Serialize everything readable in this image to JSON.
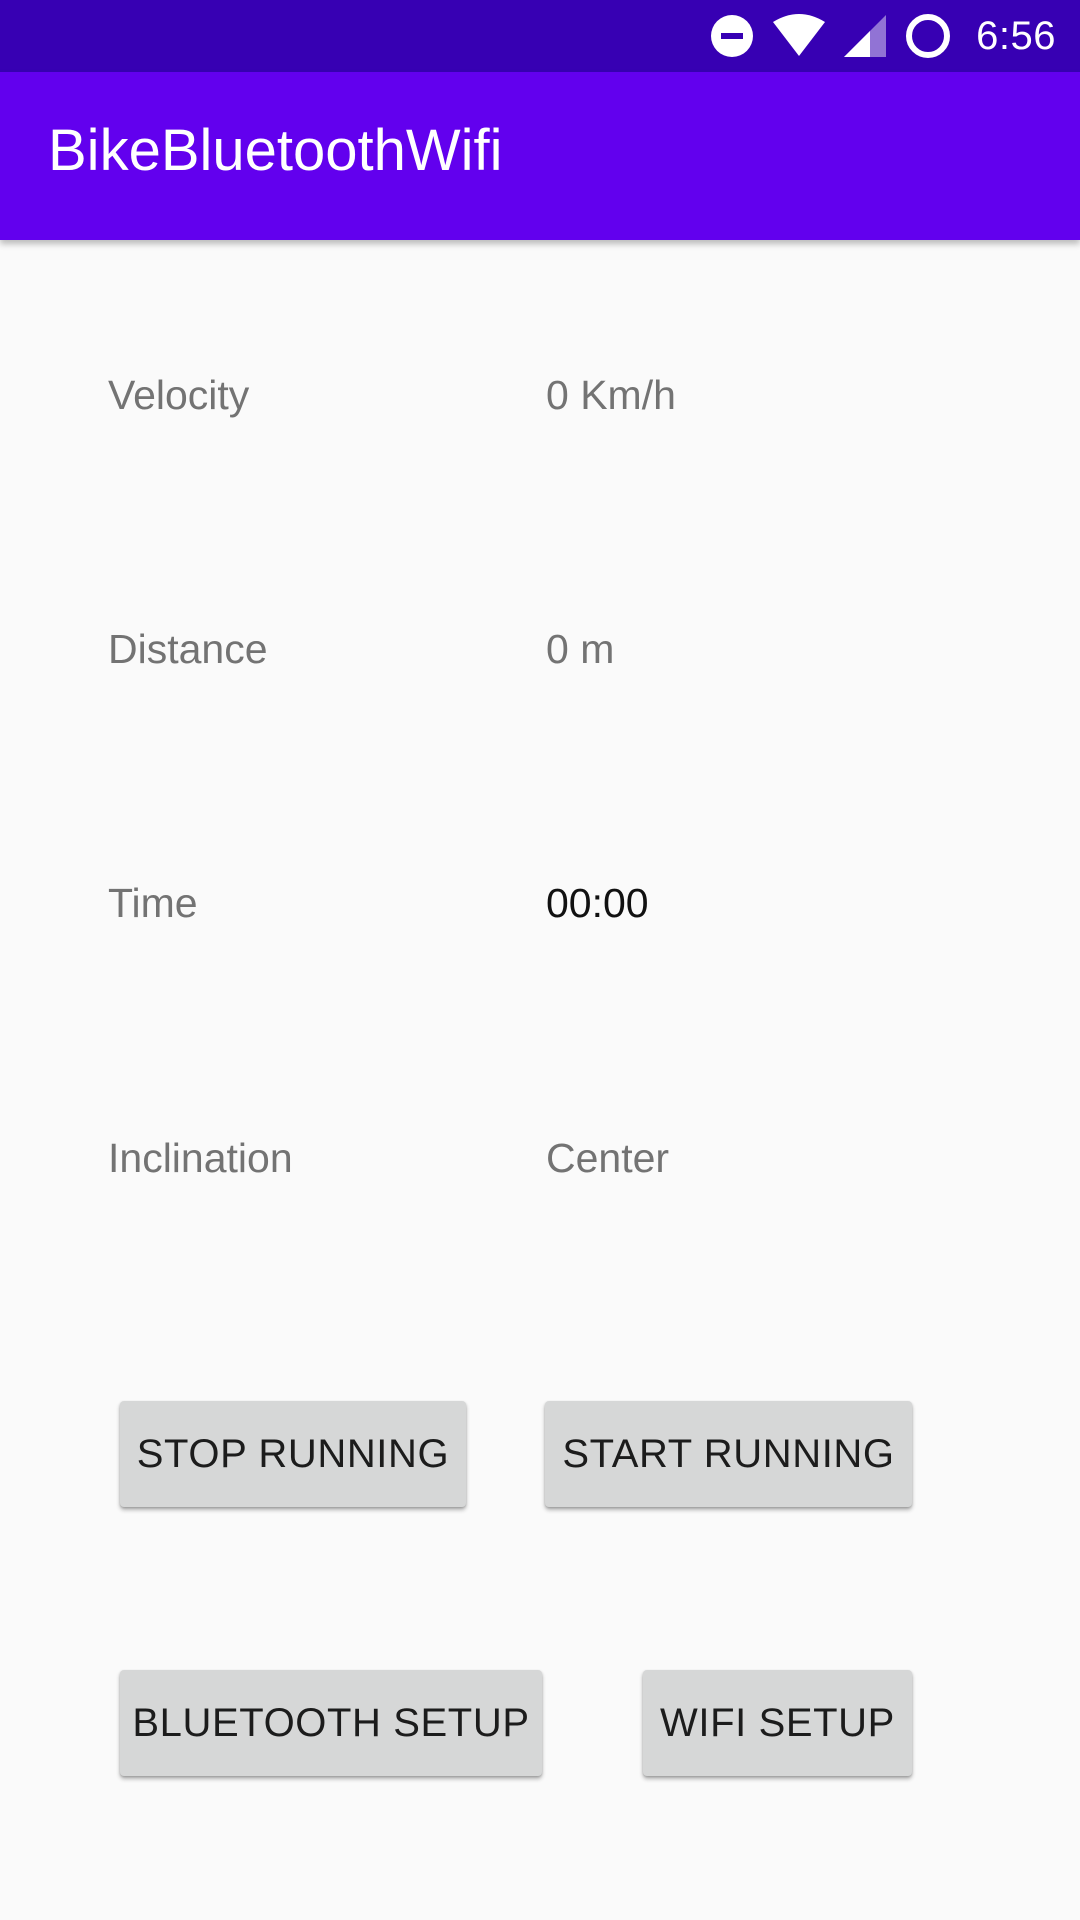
{
  "status_bar": {
    "time": "6:56",
    "icons": [
      "do-not-disturb-icon",
      "wifi-icon",
      "cellular-signal-icon",
      "battery-saver-icon"
    ]
  },
  "app_bar": {
    "title": "BikeBluetoothWifi"
  },
  "metrics": [
    {
      "label": "Velocity",
      "value": "0 Km/h"
    },
    {
      "label": "Distance",
      "value": "0 m"
    },
    {
      "label": "Time",
      "value": "00:00"
    },
    {
      "label": "Inclination",
      "value": "Center"
    }
  ],
  "buttons": {
    "stop_running": "STOP RUNNING",
    "start_running": "START RUNNING",
    "bluetooth_setup": "BLUETOOTH SETUP",
    "wifi_setup": "WIFI SETUP"
  },
  "colors": {
    "status_bar": "#3700b3",
    "app_bar": "#6200ee",
    "background": "#fafafa",
    "button": "#d6d7d7"
  }
}
